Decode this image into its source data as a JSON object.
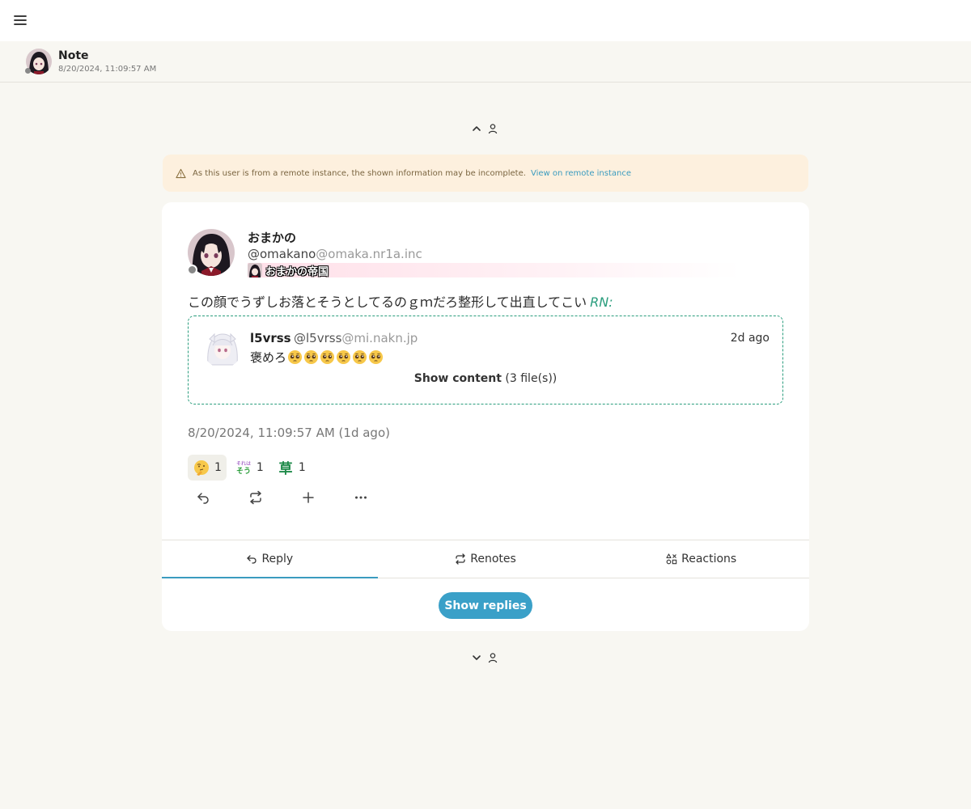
{
  "topbar": {
    "menu_icon": "menu-icon"
  },
  "page_header": {
    "title": "Note",
    "subtitle": "8/20/2024, 11:09:57 AM"
  },
  "warning": {
    "text": "As this user is from a remote instance, the shown information may be incomplete.",
    "link": "View on remote instance"
  },
  "note": {
    "username": "おまかの",
    "handle_user": "@omakano",
    "handle_host": "@omaka.nr1a.inc",
    "instance_name": "おまかの帝国",
    "text": "この顔でうずしお落とそうとしてるのｇｍだろ整形して出直してこい",
    "rn_label": "RN:",
    "timestamp": "8/20/2024, 11:09:57 AM (1d ago)"
  },
  "quote": {
    "username": "l5vrss",
    "handle_user": "@l5vrss",
    "handle_host": "@mi.nakn.jp",
    "time": "2d ago",
    "text": "褒めろ",
    "emoji_count": 6,
    "show_label": "Show content",
    "file_count": "(3 file(s))"
  },
  "reactions": [
    {
      "icon": "thinking-face-icon",
      "count": "1",
      "active": true
    },
    {
      "icon": "soreha-sou-icon",
      "count": "1",
      "active": false
    },
    {
      "icon": "kusa-icon",
      "count": "1",
      "active": false
    }
  ],
  "tabs": [
    {
      "label": "Reply",
      "icon": "reply-icon",
      "active": true
    },
    {
      "label": "Renotes",
      "icon": "renote-icon",
      "active": false
    },
    {
      "label": "Reactions",
      "icon": "reactions-icon",
      "active": false
    }
  ],
  "show_replies": "Show replies",
  "colors": {
    "accent": "#3aa0c8",
    "renote": "#2a9d7d",
    "warning_bg": "#fdf0de"
  }
}
